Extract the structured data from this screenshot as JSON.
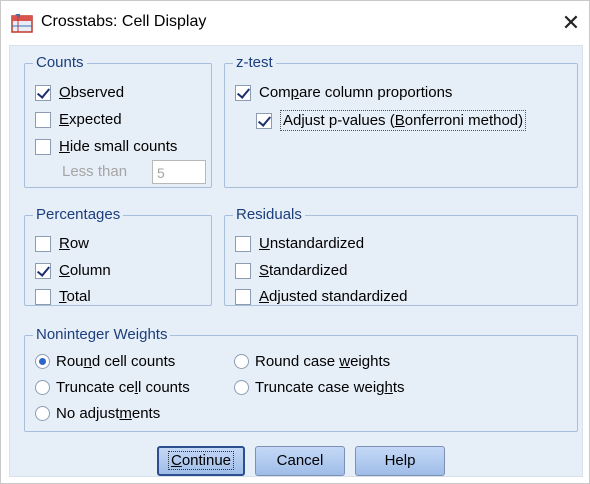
{
  "window": {
    "title": "Crosstabs: Cell Display",
    "close_glyph": "✕",
    "icon": "crosstabs-table-icon"
  },
  "counts": {
    "legend": "Counts",
    "observed": {
      "pre": "",
      "u": "O",
      "post": "bserved",
      "checked": true
    },
    "expected": {
      "pre": "",
      "u": "E",
      "post": "xpected",
      "checked": false
    },
    "hide_small": {
      "pre": "",
      "u": "H",
      "post": "ide small counts",
      "checked": false
    },
    "less_than_label": "Less than",
    "less_than_value": "5"
  },
  "ztest": {
    "legend": "z-test",
    "compare": {
      "pre": "Com",
      "u": "p",
      "post": "are column proportions",
      "checked": true
    },
    "adjust": {
      "pre": "Adjust p-values (",
      "u": "B",
      "post": "onferroni method)",
      "checked": true
    }
  },
  "percentages": {
    "legend": "Percentages",
    "row": {
      "pre": "",
      "u": "R",
      "post": "ow",
      "checked": false
    },
    "column": {
      "pre": "",
      "u": "C",
      "post": "olumn",
      "checked": true
    },
    "total": {
      "pre": "",
      "u": "T",
      "post": "otal",
      "checked": false
    }
  },
  "residuals": {
    "legend": "Residuals",
    "unstandardized": {
      "pre": "",
      "u": "U",
      "post": "nstandardized",
      "checked": false
    },
    "standardized": {
      "pre": "",
      "u": "S",
      "post": "tandardized",
      "checked": false
    },
    "adjusted": {
      "pre": "",
      "u": "A",
      "post": "djusted standardized",
      "checked": false
    }
  },
  "noninteger": {
    "legend": "Noninteger Weights",
    "round_cell": {
      "pre": "Rou",
      "u": "n",
      "post": "d cell counts",
      "selected": true
    },
    "round_case": {
      "pre": "Round case ",
      "u": "w",
      "post": "eights",
      "selected": false
    },
    "truncate_cell": {
      "pre": "Truncate ce",
      "u": "l",
      "post": "l counts",
      "selected": false
    },
    "truncate_case": {
      "pre": "Truncate case weig",
      "u": "h",
      "post": "ts",
      "selected": false
    },
    "no_adjust": {
      "pre": "No adjust",
      "u": "m",
      "post": "ents",
      "selected": false
    }
  },
  "buttons": {
    "continue": {
      "pre": "",
      "u": "C",
      "post": "ontinue"
    },
    "cancel": "Cancel",
    "help": "Help"
  },
  "colors": {
    "client_bg": "#e6eef8",
    "legend_text": "#1b3e7b",
    "group_border": "#a8bfdc",
    "button_fill": "#b3cdf1",
    "radio_dot": "#2c64c8"
  }
}
